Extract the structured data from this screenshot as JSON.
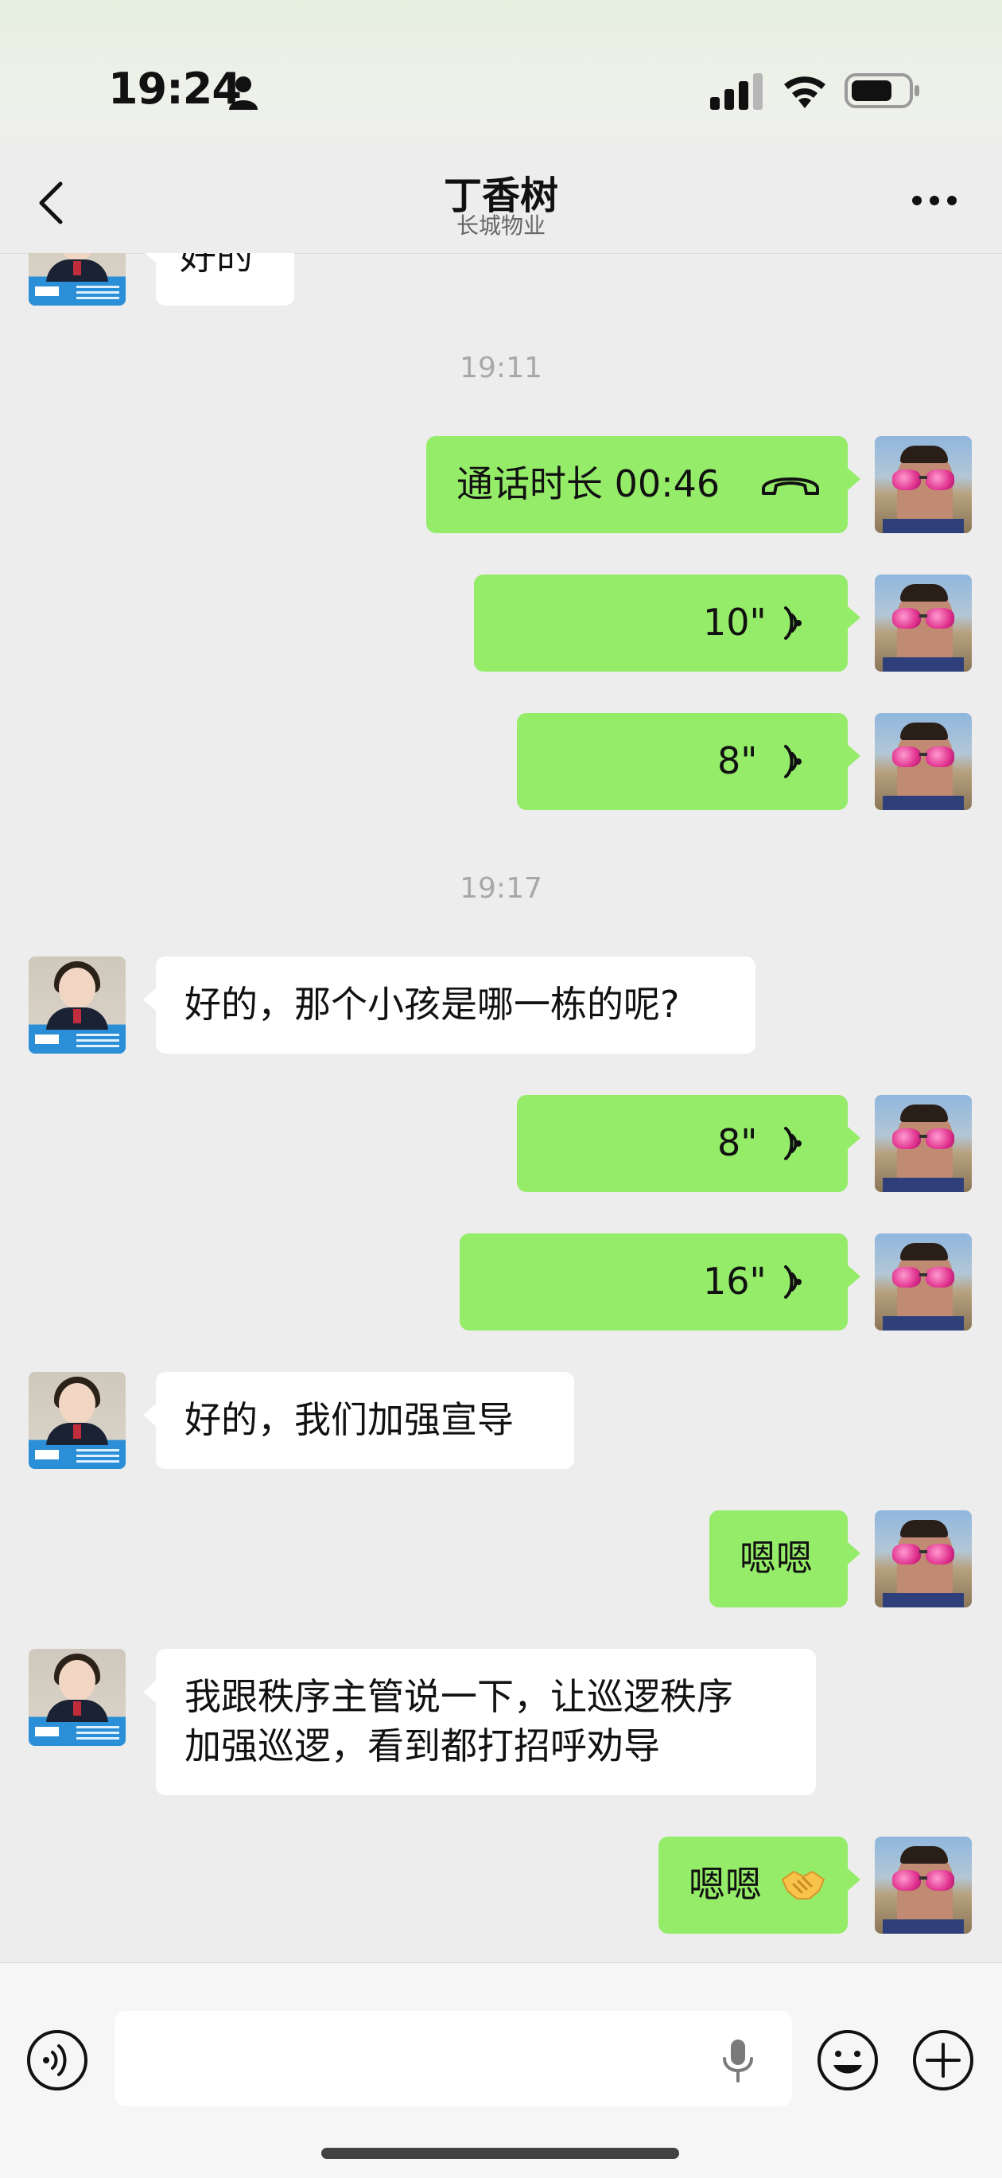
{
  "status_bar": {
    "time": "19:24",
    "icons": [
      "person-icon",
      "signal-icon",
      "wifi-icon",
      "battery-icon"
    ]
  },
  "header": {
    "title": "丁香树",
    "subtitle": "长城物业",
    "left_icon": "back-icon",
    "right_icon": "more-icon"
  },
  "messages": {
    "partial_top": "好的",
    "ts1": "19:11",
    "m1_call": "通话时长 00:46",
    "m2_voice": "10\"",
    "m3_voice": "8\"",
    "ts2": "19:17",
    "m4_text": "好的，那个小孩是哪一栋的呢?",
    "m5_voice": "8\"",
    "m6_voice": "16\"",
    "m7_text": "好的，我们加强宣导",
    "m8_text": "嗯嗯",
    "m9_line1": "我跟秩序主管说一下，让巡逻秩序",
    "m9_line2": "加强巡逻，看到都打招呼劝导",
    "m10_text": "嗯嗯",
    "m10_emoji": "handshake-icon"
  },
  "input_bar": {
    "value": "",
    "icons": [
      "voice-input-icon",
      "mic-icon",
      "emoji-icon",
      "plus-icon"
    ]
  },
  "colors": {
    "background": "#ededed",
    "sent_bubble": "#95ec69",
    "received_bubble": "#ffffff",
    "timestamp": "#a8a8a8"
  }
}
